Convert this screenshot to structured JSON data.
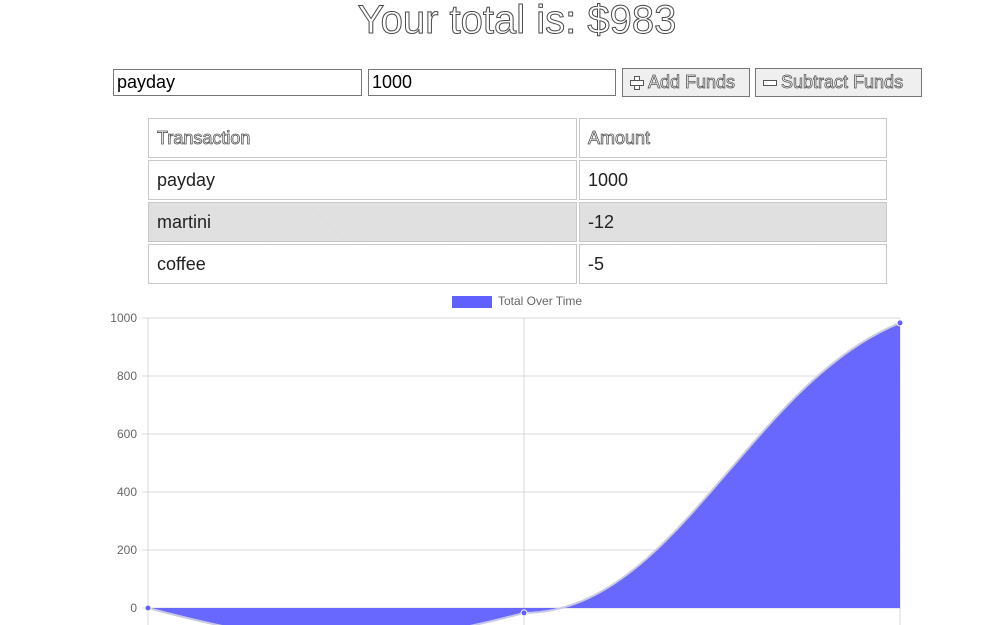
{
  "header": {
    "total_text": "Your total is: $983"
  },
  "form": {
    "name_value": "payday",
    "amount_value": "1000",
    "add_label": "Add Funds",
    "subtract_label": "Subtract Funds",
    "add_icon": "plus-icon",
    "subtract_icon": "minus-icon"
  },
  "table": {
    "headers": [
      "Transaction",
      "Amount"
    ],
    "rows": [
      {
        "name": "payday",
        "amount": "1000"
      },
      {
        "name": "martini",
        "amount": "-12"
      },
      {
        "name": "coffee",
        "amount": "-5"
      }
    ]
  },
  "chart_data": {
    "type": "area",
    "legend": [
      "Total Over Time"
    ],
    "legend_position": "top-center",
    "x": [
      0,
      1,
      2
    ],
    "series": [
      {
        "name": "Total Over Time",
        "values": [
          0,
          -17,
          983
        ],
        "color": "#6060ff"
      }
    ],
    "yticks": [
      0,
      200,
      400,
      600,
      800,
      1000
    ],
    "ylim": [
      -60,
      1000
    ],
    "grid": true
  }
}
